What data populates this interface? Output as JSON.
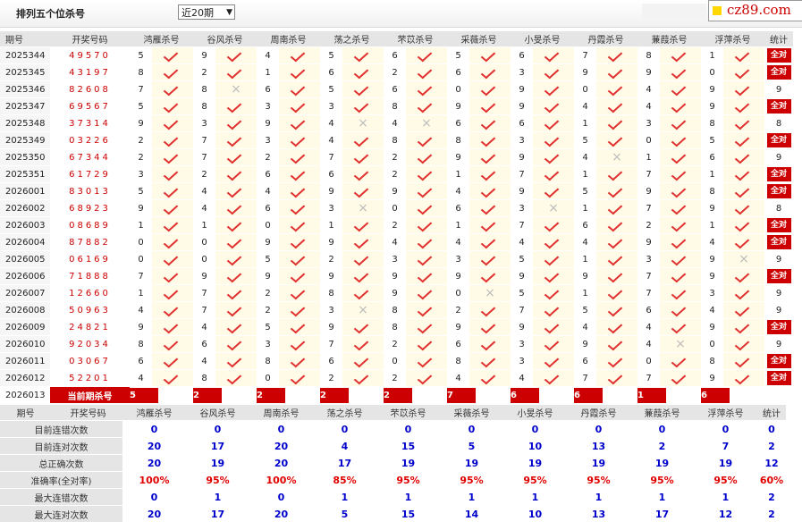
{
  "header": {
    "title": "排列五个位杀号",
    "period_select": "近20期",
    "logo": "cz89.com"
  },
  "columns": [
    "期号",
    "开奖号码",
    "鸿雁杀号",
    "谷风杀号",
    "周南杀号",
    "荡之杀号",
    "芣苡杀号",
    "采薇杀号",
    "小旻杀号",
    "丹霞杀号",
    "蒹葭杀号",
    "浮萍杀号",
    "统计"
  ],
  "rows": [
    {
      "period": "2025344",
      "number": "49570",
      "kills": [
        "5",
        "9",
        "4",
        "5",
        "6",
        "5",
        "6",
        "7",
        "8",
        "1"
      ],
      "marks": [
        1,
        1,
        1,
        1,
        1,
        1,
        1,
        1,
        1,
        1
      ],
      "stat": "全对"
    },
    {
      "period": "2025345",
      "number": "43197",
      "kills": [
        "8",
        "2",
        "1",
        "6",
        "2",
        "6",
        "3",
        "9",
        "9",
        "0"
      ],
      "marks": [
        1,
        1,
        1,
        1,
        1,
        1,
        1,
        1,
        1,
        1
      ],
      "stat": "全对"
    },
    {
      "period": "2025346",
      "number": "82608",
      "kills": [
        "7",
        "8",
        "6",
        "5",
        "6",
        "0",
        "9",
        "0",
        "4",
        "9"
      ],
      "marks": [
        1,
        0,
        1,
        1,
        1,
        1,
        1,
        1,
        1,
        1
      ],
      "stat": "9"
    },
    {
      "period": "2025347",
      "number": "69567",
      "kills": [
        "5",
        "8",
        "3",
        "3",
        "8",
        "9",
        "9",
        "4",
        "4",
        "9"
      ],
      "marks": [
        1,
        1,
        1,
        1,
        1,
        1,
        1,
        1,
        1,
        1
      ],
      "stat": "全对"
    },
    {
      "period": "2025348",
      "number": "37314",
      "kills": [
        "9",
        "3",
        "9",
        "4",
        "4",
        "6",
        "6",
        "1",
        "3",
        "8"
      ],
      "marks": [
        1,
        1,
        1,
        0,
        0,
        1,
        1,
        1,
        1,
        1
      ],
      "stat": "8"
    },
    {
      "period": "2025349",
      "number": "03226",
      "kills": [
        "2",
        "7",
        "3",
        "4",
        "8",
        "8",
        "3",
        "5",
        "0",
        "5"
      ],
      "marks": [
        1,
        1,
        1,
        1,
        1,
        1,
        1,
        1,
        1,
        1
      ],
      "stat": "全对"
    },
    {
      "period": "2025350",
      "number": "67344",
      "kills": [
        "2",
        "7",
        "2",
        "7",
        "2",
        "9",
        "9",
        "4",
        "1",
        "6"
      ],
      "marks": [
        1,
        1,
        1,
        1,
        1,
        1,
        1,
        0,
        1,
        1
      ],
      "stat": "9"
    },
    {
      "period": "2025351",
      "number": "61729",
      "kills": [
        "3",
        "2",
        "6",
        "6",
        "2",
        "1",
        "7",
        "1",
        "7",
        "1"
      ],
      "marks": [
        1,
        1,
        1,
        1,
        1,
        1,
        1,
        1,
        1,
        1
      ],
      "stat": "全对"
    },
    {
      "period": "2026001",
      "number": "83013",
      "kills": [
        "5",
        "4",
        "4",
        "9",
        "9",
        "4",
        "9",
        "5",
        "9",
        "8"
      ],
      "marks": [
        1,
        1,
        1,
        1,
        1,
        1,
        1,
        1,
        1,
        1
      ],
      "stat": "全对"
    },
    {
      "period": "2026002",
      "number": "68923",
      "kills": [
        "9",
        "4",
        "6",
        "3",
        "0",
        "6",
        "3",
        "1",
        "7",
        "9"
      ],
      "marks": [
        1,
        1,
        1,
        0,
        1,
        1,
        0,
        1,
        1,
        1
      ],
      "stat": "8"
    },
    {
      "period": "2026003",
      "number": "08689",
      "kills": [
        "1",
        "1",
        "0",
        "1",
        "2",
        "1",
        "7",
        "6",
        "2",
        "1"
      ],
      "marks": [
        1,
        1,
        1,
        1,
        1,
        1,
        1,
        1,
        1,
        1
      ],
      "stat": "全对"
    },
    {
      "period": "2026004",
      "number": "87882",
      "kills": [
        "0",
        "0",
        "9",
        "9",
        "4",
        "4",
        "4",
        "4",
        "9",
        "4"
      ],
      "marks": [
        1,
        1,
        1,
        1,
        1,
        1,
        1,
        1,
        1,
        1
      ],
      "stat": "全对"
    },
    {
      "period": "2026005",
      "number": "06169",
      "kills": [
        "0",
        "0",
        "5",
        "2",
        "3",
        "3",
        "5",
        "1",
        "3",
        "9"
      ],
      "marks": [
        1,
        1,
        1,
        1,
        1,
        1,
        1,
        1,
        1,
        0
      ],
      "stat": "9"
    },
    {
      "period": "2026006",
      "number": "71888",
      "kills": [
        "7",
        "9",
        "9",
        "9",
        "9",
        "9",
        "9",
        "9",
        "7",
        "9"
      ],
      "marks": [
        1,
        1,
        1,
        1,
        1,
        1,
        1,
        1,
        1,
        1
      ],
      "stat": "全对"
    },
    {
      "period": "2026007",
      "number": "12660",
      "kills": [
        "1",
        "7",
        "2",
        "8",
        "9",
        "0",
        "5",
        "1",
        "7",
        "3"
      ],
      "marks": [
        1,
        1,
        1,
        1,
        1,
        0,
        1,
        1,
        1,
        1
      ],
      "stat": "9"
    },
    {
      "period": "2026008",
      "number": "50963",
      "kills": [
        "4",
        "7",
        "2",
        "3",
        "8",
        "2",
        "7",
        "5",
        "6",
        "4"
      ],
      "marks": [
        1,
        1,
        1,
        0,
        1,
        1,
        1,
        1,
        1,
        1
      ],
      "stat": "9"
    },
    {
      "period": "2026009",
      "number": "24821",
      "kills": [
        "9",
        "4",
        "5",
        "9",
        "8",
        "9",
        "9",
        "4",
        "4",
        "9"
      ],
      "marks": [
        1,
        1,
        1,
        1,
        1,
        1,
        1,
        1,
        1,
        1
      ],
      "stat": "全对"
    },
    {
      "period": "2026010",
      "number": "92034",
      "kills": [
        "8",
        "6",
        "3",
        "7",
        "2",
        "6",
        "3",
        "9",
        "4",
        "0"
      ],
      "marks": [
        1,
        1,
        1,
        1,
        1,
        1,
        1,
        1,
        0,
        1
      ],
      "stat": "9"
    },
    {
      "period": "2026011",
      "number": "03067",
      "kills": [
        "6",
        "4",
        "8",
        "6",
        "0",
        "8",
        "3",
        "6",
        "0",
        "8"
      ],
      "marks": [
        1,
        1,
        1,
        1,
        1,
        1,
        1,
        1,
        1,
        1
      ],
      "stat": "全对"
    },
    {
      "period": "2026012",
      "number": "52201",
      "kills": [
        "4",
        "8",
        "0",
        "2",
        "2",
        "4",
        "4",
        "7",
        "7",
        "9"
      ],
      "marks": [
        1,
        1,
        1,
        1,
        1,
        1,
        1,
        1,
        1,
        1
      ],
      "stat": "全对"
    }
  ],
  "mark_labels": {
    "check": "✓",
    "cross": "×"
  },
  "current": {
    "period": "2026013",
    "label": "当前期杀号",
    "kills": [
      "5",
      "2",
      "2",
      "2",
      "2",
      "7",
      "6",
      "6",
      "1",
      "6"
    ]
  },
  "stats_header": [
    "期号",
    "开奖号码",
    "鸿雁杀号",
    "谷风杀号",
    "周南杀号",
    "荡之杀号",
    "芣苡杀号",
    "采薇杀号",
    "小旻杀号",
    "丹霞杀号",
    "蒹葭杀号",
    "浮萍杀号",
    "统计"
  ],
  "stats": [
    {
      "label": "目前连错次数",
      "values": [
        "0",
        "0",
        "0",
        "0",
        "0",
        "0",
        "0",
        "0",
        "0",
        "0"
      ],
      "last": "0"
    },
    {
      "label": "目前连对次数",
      "values": [
        "20",
        "17",
        "20",
        "4",
        "15",
        "5",
        "10",
        "13",
        "2",
        "7"
      ],
      "last": "2"
    },
    {
      "label": "总正确次数",
      "values": [
        "20",
        "19",
        "20",
        "17",
        "19",
        "19",
        "19",
        "19",
        "19",
        "19"
      ],
      "last": "12"
    },
    {
      "label": "准确率(全对率)",
      "values": [
        "100%",
        "95%",
        "100%",
        "85%",
        "95%",
        "95%",
        "95%",
        "95%",
        "95%",
        "95%"
      ],
      "last": "60%",
      "red": true
    },
    {
      "label": "最大连错次数",
      "values": [
        "0",
        "1",
        "0",
        "1",
        "1",
        "1",
        "1",
        "1",
        "1",
        "1"
      ],
      "last": "2"
    },
    {
      "label": "最大连对次数",
      "values": [
        "20",
        "17",
        "20",
        "5",
        "15",
        "14",
        "10",
        "13",
        "17",
        "12"
      ],
      "last": "2"
    }
  ]
}
